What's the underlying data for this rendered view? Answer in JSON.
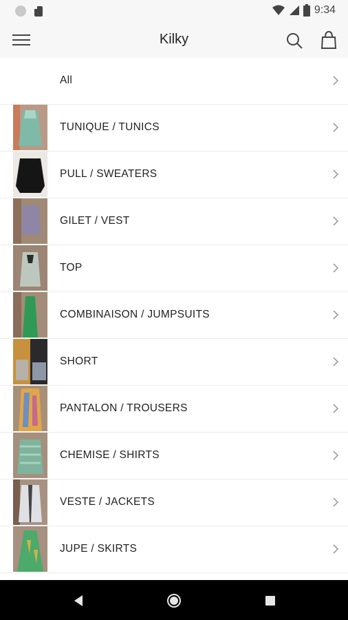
{
  "status": {
    "time": "9:34"
  },
  "appbar": {
    "title": "Kilky"
  },
  "colors": {
    "background": "#ffffff",
    "bar": "#f7f7f7",
    "divider": "#ececec",
    "text": "#222222",
    "chevron": "#9e9e9e",
    "nav": "#000000"
  },
  "icons": [
    "menu-icon",
    "search-icon",
    "shopping-bag-icon",
    "chevron-right-icon",
    "back-icon",
    "home-icon",
    "recents-icon"
  ],
  "categories": [
    {
      "label": "All"
    },
    {
      "label": "TUNIQUE / TUNICS"
    },
    {
      "label": "PULL / SWEATERS"
    },
    {
      "label": "GILET / VEST"
    },
    {
      "label": "TOP"
    },
    {
      "label": "COMBINAISON / JUMPSUITS"
    },
    {
      "label": "SHORT"
    },
    {
      "label": "PANTALON / TROUSERS"
    },
    {
      "label": "CHEMISE / SHIRTS"
    },
    {
      "label": "VESTE / JACKETS"
    },
    {
      "label": "JUPE / SKIRTS"
    }
  ]
}
